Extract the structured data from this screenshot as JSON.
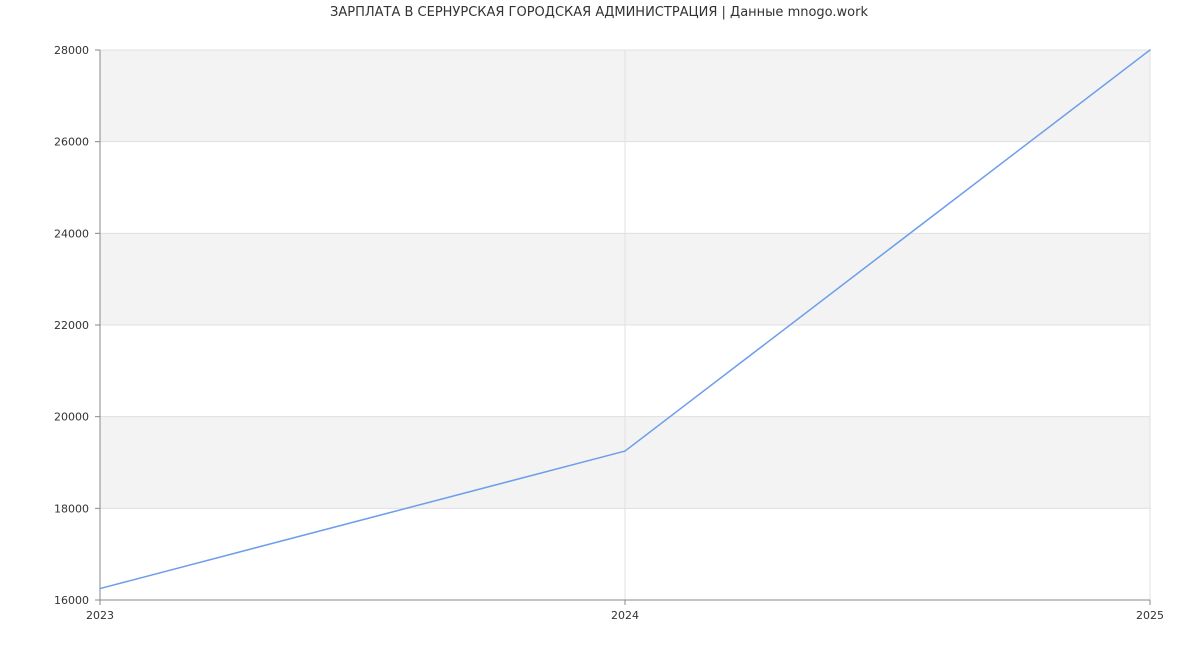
{
  "chart_data": {
    "type": "line",
    "title": "ЗАРПЛАТА В СЕРНУРСКАЯ ГОРОДСКАЯ АДМИНИСТРАЦИЯ | Данные mnogo.work",
    "xlabel": "",
    "ylabel": "",
    "x": [
      2023,
      2024,
      2025
    ],
    "x_tick_labels": [
      "2023",
      "2024",
      "2025"
    ],
    "y_ticks": [
      16000,
      18000,
      20000,
      22000,
      24000,
      26000,
      28000
    ],
    "y_tick_labels": [
      "16000",
      "18000",
      "20000",
      "22000",
      "24000",
      "26000",
      "28000"
    ],
    "xlim": [
      2023,
      2025
    ],
    "ylim": [
      16000,
      28000
    ],
    "grid": true,
    "legend": "none",
    "series": [
      {
        "values": [
          16250,
          19250,
          28000
        ],
        "color": "#6d9eeb"
      }
    ],
    "colors": {
      "band": "#f3f3f3",
      "grid": "#e0e0e0",
      "axis": "#888888"
    }
  }
}
